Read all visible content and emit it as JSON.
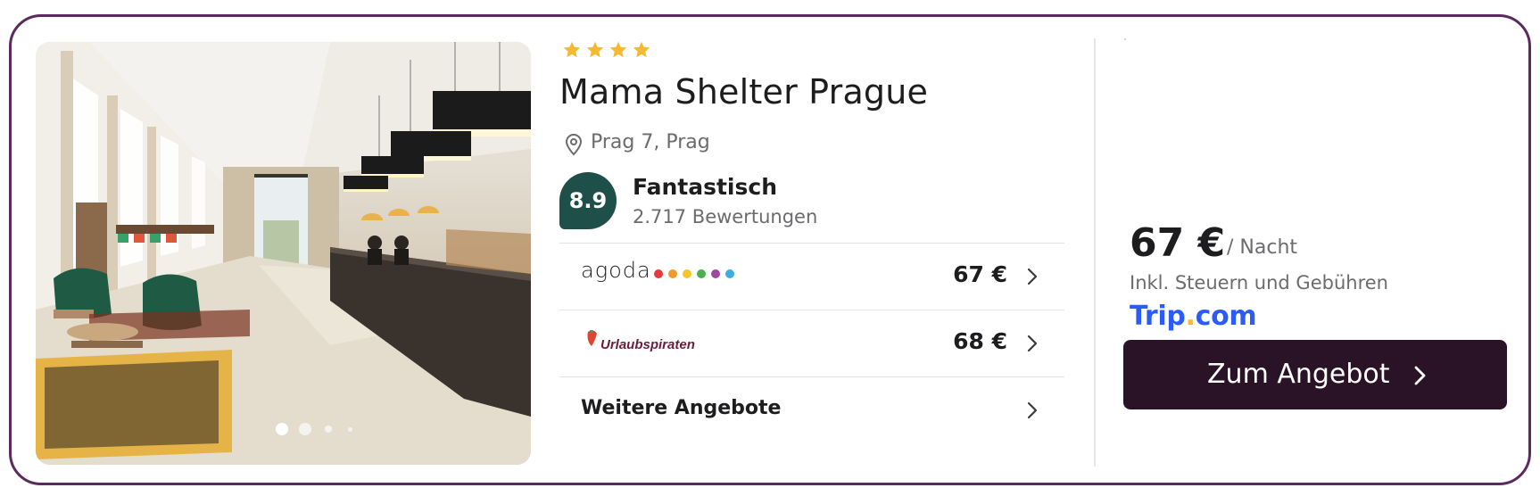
{
  "hotel": {
    "star_count": 4,
    "name": "Mama Shelter Prague",
    "location": "Prag 7, Prag",
    "rating": {
      "score": "8.9",
      "word": "Fantastisch",
      "reviews": "2.717 Bewertungen"
    },
    "photo": {
      "slide_count": 4,
      "active_slide": 1
    }
  },
  "offers": [
    {
      "provider": "agoda",
      "price": "67 €",
      "icon": "agoda-logo"
    },
    {
      "provider": "Urlaubspiraten",
      "price": "68 €",
      "icon": "urlaubspiraten-logo"
    }
  ],
  "more_offers_label": "Weitere Angebote",
  "best_offer": {
    "price": "67 €",
    "unit": "/ Nacht",
    "tax_note": "Inkl. Steuern und Gebühren",
    "provider_name": "Trip",
    "provider_tld": "com",
    "provider_dot": "."
  },
  "cta": {
    "label": "Zum Angebot",
    "icon": "chevron-right-icon"
  },
  "colors": {
    "border": "#5b2a5e",
    "score_badge": "#1f4f49",
    "cta_background": "#2b1327",
    "star": "#f5b933",
    "provider_blue": "#2b5cf5",
    "agoda_dots": [
      "#e8383d",
      "#f29a2e",
      "#f5c32a",
      "#48b14d",
      "#9b4a9f",
      "#3ab0e2"
    ]
  }
}
